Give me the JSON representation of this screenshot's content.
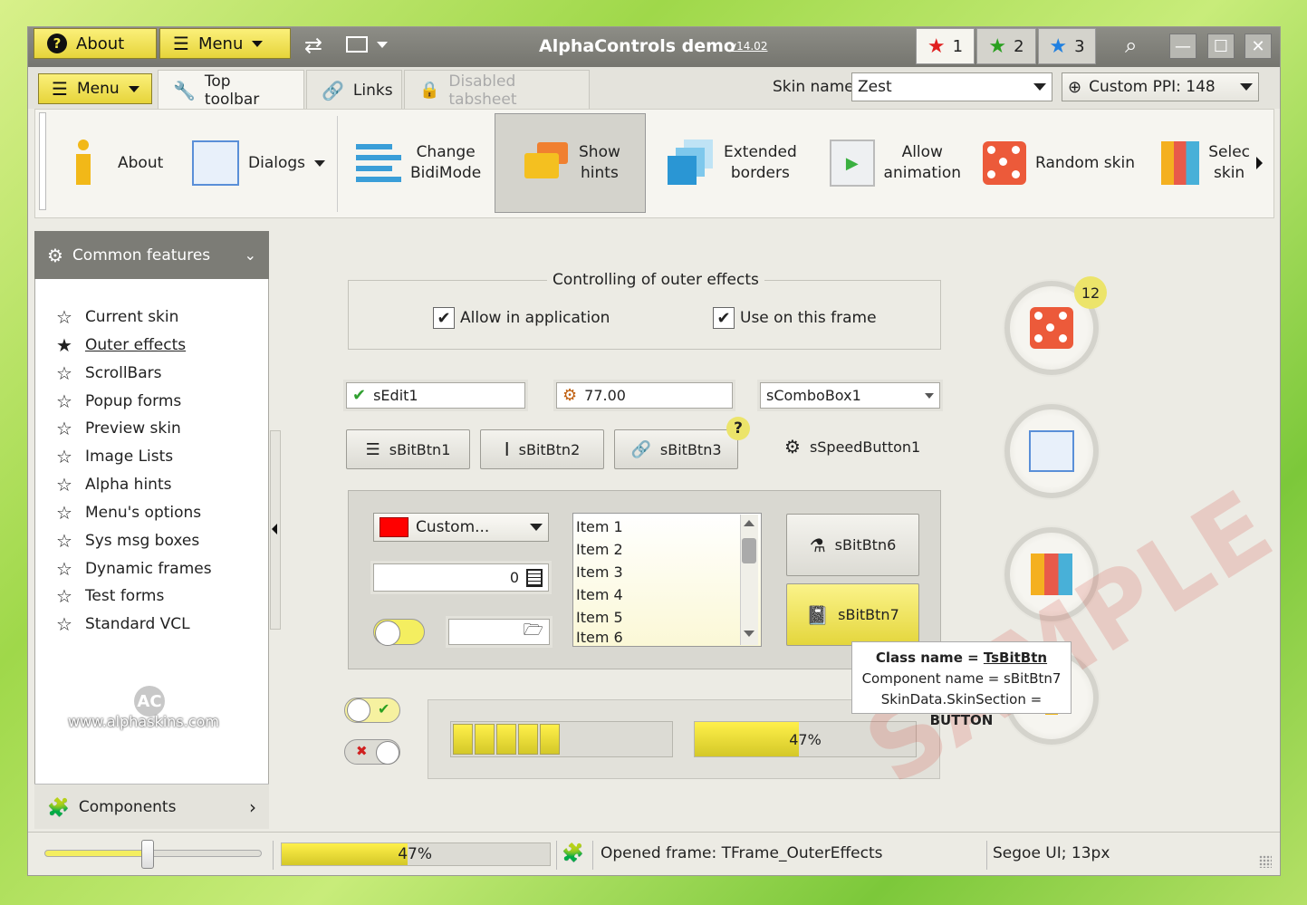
{
  "window": {
    "about_label": "About",
    "menu_label": "Menu",
    "title": "AlphaControls demo",
    "version": "v14.02",
    "tabs": [
      "1",
      "2",
      "3"
    ]
  },
  "tabbar": {
    "menu_label": "Menu",
    "tabs": [
      {
        "label": "Top toolbar"
      },
      {
        "label": "Links"
      },
      {
        "label": "Disabled tabsheet"
      }
    ],
    "skin_label": "Skin name:",
    "skin_value": "Zest",
    "ppi_label": "Custom PPI: 148"
  },
  "toolbar": {
    "about": "About",
    "dialogs": "Dialogs",
    "bidi_1": "Change",
    "bidi_2": "BidiMode",
    "hints_1": "Show",
    "hints_2": "hints",
    "borders_1": "Extended",
    "borders_2": "borders",
    "anim_1": "Allow",
    "anim_2": "animation",
    "random": "Random skin",
    "select_1": "Selec",
    "select_2": "skin"
  },
  "sidebar": {
    "header": "Common features",
    "items": [
      "Current skin",
      "Outer effects",
      "ScrollBars",
      "Popup forms",
      "Preview skin",
      "Image Lists",
      "Alpha hints",
      "Menu's options",
      "Sys msg boxes",
      "Dynamic frames",
      "Test forms",
      "Standard VCL"
    ],
    "logo_text": "www.alphaskins.com",
    "footer": "Components"
  },
  "main": {
    "group_title": "Controlling of outer effects",
    "allow_app": "Allow in application",
    "use_frame": "Use on this frame",
    "edit1": "sEdit1",
    "edit2": "77.00",
    "combo1": "sComboBox1",
    "btn1": "sBitBtn1",
    "btn2": "sBitBtn2",
    "btn3": "sBitBtn3",
    "speed": "sSpeedButton1",
    "color_combo": "Custom...",
    "calc_value": "0",
    "list_items": [
      "Item 1",
      "Item 2",
      "Item 3",
      "Item 4",
      "Item 5",
      "Item 6"
    ],
    "btn6": "sBitBtn6",
    "btn7": "sBitBtn7",
    "badge": "12",
    "progress_label": "47%",
    "progress_value": 0.47,
    "watermark": "SAMPLE"
  },
  "tooltip": {
    "class_label": "Class name = ",
    "class_value": "TsBitBtn",
    "component": "Component name = sBitBtn7",
    "skin_label": "SkinData.SkinSection = ",
    "skin_value": "BUTTON"
  },
  "status": {
    "progress_label": "47%",
    "progress_value": 0.47,
    "frame": "Opened frame: TFrame_OuterEffects",
    "font": "Segoe UI; 13px"
  },
  "colors": {
    "accent": "#f0e23a",
    "title_bar": "#808079",
    "red": "#ff0000"
  }
}
